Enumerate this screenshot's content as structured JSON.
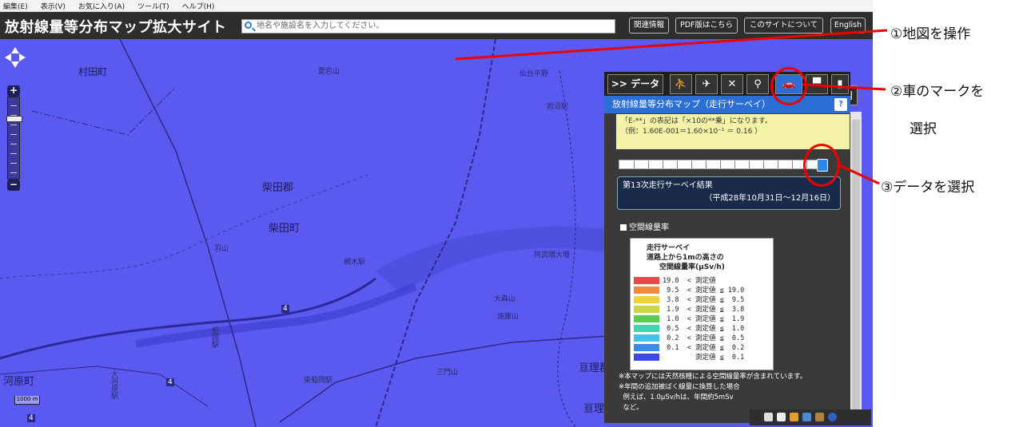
{
  "menubar": {
    "items": [
      "編集(E)",
      "表示(V)",
      "お気に入り(A)",
      "ツール(T)",
      "ヘルプ(H)"
    ]
  },
  "header": {
    "title": "放射線量等分布マップ拡大サイト",
    "search_placeholder": "地名や施設名を入力してください。",
    "buttons": [
      "関連情報",
      "PDF版はこちら",
      "このサイトについて",
      "English"
    ]
  },
  "map": {
    "labels": [
      "村田町",
      "柴田郡",
      "柴田町",
      "河原町",
      "亘理郡",
      "亘理町",
      "大森山",
      "遠藤山",
      "愛宕山",
      "仙台平野",
      "岩沼駅",
      "槻木駅",
      "阿武隈大堰",
      "船岡駅",
      "東船岡駅",
      "三門山",
      "羽山",
      "大河原駅"
    ],
    "road_numbers": [
      "4",
      "4",
      "4"
    ],
    "scale_label": "1000 m"
  },
  "panel": {
    "data_tab": ">> データ",
    "title": "放射線量等分布マップ（走行サーベイ）",
    "help": "?",
    "note_lines": [
      "「E-**」の表記は「×10の**乗」になります。",
      "（例：1.60E-001＝1.60×10⁻¹ ＝ 0.16 ）"
    ],
    "slider_position": 1.0,
    "survey_title": "第13次走行サーベイ結果",
    "survey_period": "（平成28年10月31日～12月16日）",
    "checkbox_label": "空間線量率",
    "legend": {
      "title_lines": [
        "走行サーベイ",
        "道路上から1mの高さの",
        "空間線量率(μSv/h)"
      ],
      "rows": [
        {
          "color": "#e84848",
          "text": "19.0  < 測定値"
        },
        {
          "color": "#f08a3c",
          "text": " 9.5  < 測定値 ≦ 19.0"
        },
        {
          "color": "#f2d23c",
          "text": " 3.8  < 測定値 ≦  9.5"
        },
        {
          "color": "#c8d845",
          "text": " 1.9  < 測定値 ≦  3.8"
        },
        {
          "color": "#5ccc50",
          "text": " 1.0  < 測定値 ≦  1.9"
        },
        {
          "color": "#3dd6b0",
          "text": " 0.5  < 測定値 ≦  1.0"
        },
        {
          "color": "#45c2e8",
          "text": " 0.2  < 測定値 ≦  0.5"
        },
        {
          "color": "#3a8ae6",
          "text": " 0.1  < 測定値 ≦  0.2"
        },
        {
          "color": "#3d48e8",
          "text": "        測定値 ≦  0.1"
        }
      ]
    },
    "footnotes": [
      "※本マップには天然核種による空間線量率が含まれています。",
      "※年間の追加被ばく線量に換算した場合",
      "  例えば、1.0μSv/hは、年間約5mSv",
      "  など。"
    ]
  },
  "annotations": [
    "①地図を操作",
    "②車のマークを",
    "選択",
    "③データを選択"
  ],
  "colors": {
    "map_fill": "#5b5af0",
    "accent": "#2b6fd6",
    "highlight": "#e00000"
  }
}
